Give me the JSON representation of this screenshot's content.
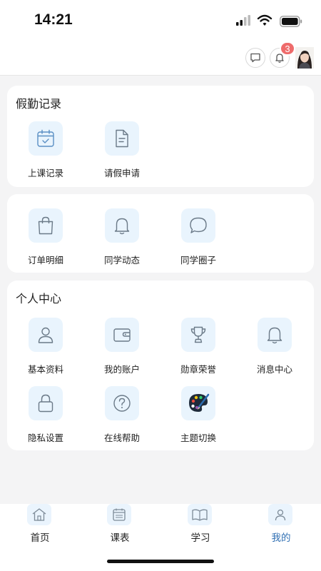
{
  "status_bar": {
    "time": "14:21"
  },
  "header": {
    "notification_count": "3"
  },
  "attendance": {
    "title": "假勤记录",
    "items": [
      {
        "label": "上课记录",
        "icon": "calendar-check-icon"
      },
      {
        "label": "请假申请",
        "icon": "document-icon"
      }
    ]
  },
  "social": {
    "items": [
      {
        "label": "订单明细",
        "icon": "shopping-bag-icon"
      },
      {
        "label": "同学动态",
        "icon": "bell-icon"
      },
      {
        "label": "同学圈子",
        "icon": "chat-bubble-icon"
      }
    ]
  },
  "personal": {
    "title": "个人中心",
    "items": [
      {
        "label": "基本资料",
        "icon": "user-icon"
      },
      {
        "label": "我的账户",
        "icon": "wallet-icon"
      },
      {
        "label": "勋章荣誉",
        "icon": "trophy-icon"
      },
      {
        "label": "消息中心",
        "icon": "bell-icon"
      },
      {
        "label": "隐私设置",
        "icon": "lock-icon"
      },
      {
        "label": "在线帮助",
        "icon": "help-icon"
      },
      {
        "label": "主题切换",
        "icon": "palette-icon"
      }
    ]
  },
  "tabbar": {
    "active_color": "#2f6fb3",
    "items": [
      {
        "label": "首页",
        "icon": "home-icon"
      },
      {
        "label": "课表",
        "icon": "schedule-icon"
      },
      {
        "label": "学习",
        "icon": "book-icon"
      },
      {
        "label": "我的",
        "icon": "profile-icon",
        "active": true
      }
    ]
  },
  "colors": {
    "accent": "#2f6fb3",
    "icon_bg": "#e9f4fd",
    "badge": "#ee6b6b"
  }
}
